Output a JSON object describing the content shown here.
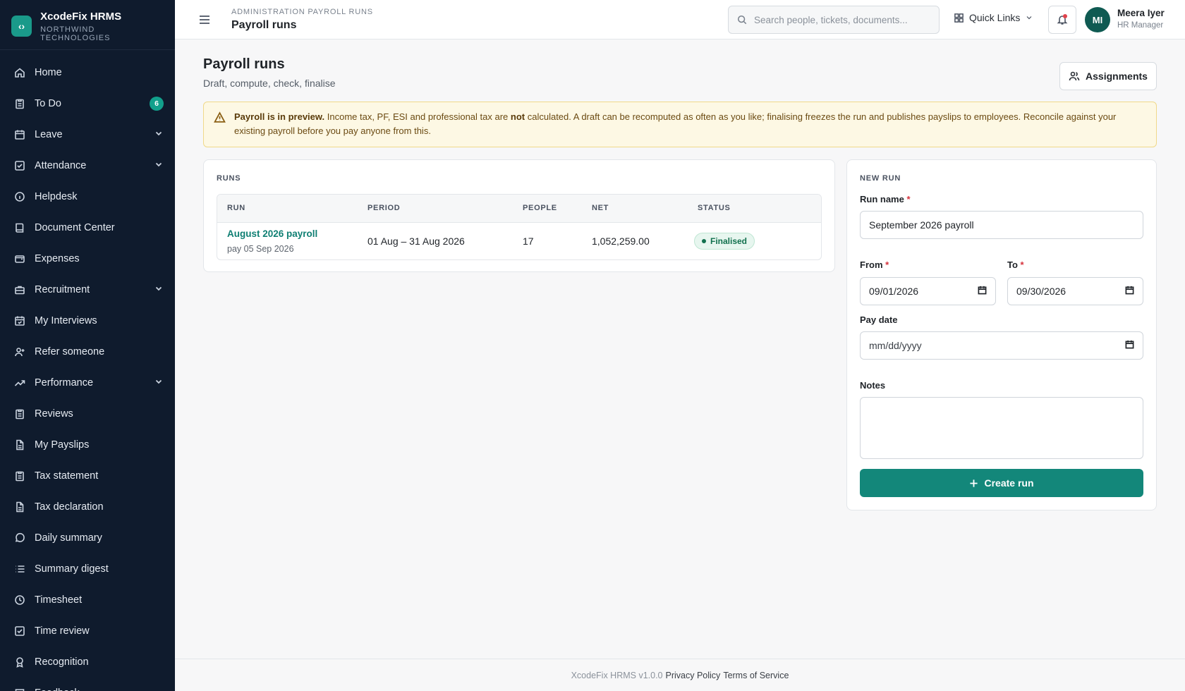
{
  "brand": {
    "name": "XcodeFix HRMS",
    "org": "NORTHWIND TECHNOLOGIES"
  },
  "sidebar": {
    "items": [
      {
        "label": "Home",
        "icon": "home-icon"
      },
      {
        "label": "To Do",
        "icon": "clipboard-icon",
        "badge": "6"
      },
      {
        "label": "Leave",
        "icon": "calendar-icon",
        "expandable": true
      },
      {
        "label": "Attendance",
        "icon": "check-square-icon",
        "expandable": true
      },
      {
        "label": "Helpdesk",
        "icon": "info-icon"
      },
      {
        "label": "Document Center",
        "icon": "book-icon"
      },
      {
        "label": "Expenses",
        "icon": "wallet-icon"
      },
      {
        "label": "Recruitment",
        "icon": "briefcase-icon",
        "expandable": true
      },
      {
        "label": "My Interviews",
        "icon": "calendar-check-icon"
      },
      {
        "label": "Refer someone",
        "icon": "user-plus-icon"
      },
      {
        "label": "Performance",
        "icon": "trending-up-icon",
        "expandable": true
      },
      {
        "label": "Reviews",
        "icon": "clipboard-icon"
      },
      {
        "label": "My Payslips",
        "icon": "file-icon"
      },
      {
        "label": "Tax statement",
        "icon": "clipboard-icon"
      },
      {
        "label": "Tax declaration",
        "icon": "file-icon"
      },
      {
        "label": "Daily summary",
        "icon": "message-circle-icon"
      },
      {
        "label": "Summary digest",
        "icon": "list-icon"
      },
      {
        "label": "Timesheet",
        "icon": "clock-icon"
      },
      {
        "label": "Time review",
        "icon": "check-square-icon"
      },
      {
        "label": "Recognition",
        "icon": "award-icon"
      },
      {
        "label": "Feedback",
        "icon": "message-icon"
      }
    ]
  },
  "header": {
    "breadcrumb": "ADMINISTRATION  PAYROLL RUNS",
    "title": "Payroll runs",
    "search_placeholder": "Search people, tickets, documents...",
    "quick_links": "Quick Links",
    "user": {
      "initials": "MI",
      "name": "Meera Iyer",
      "role": "HR Manager"
    }
  },
  "page": {
    "title": "Payroll runs",
    "subtitle": "Draft, compute, check, finalise",
    "assignments_label": "Assignments"
  },
  "alert": {
    "strong": "Payroll is in preview.",
    "text1": " Income tax, PF, ESI and professional tax are ",
    "not": "not",
    "text2": " calculated. A draft can be recomputed as often as you like; finalising freezes the run and publishes payslips to employees. Reconcile against your existing payroll before you pay anyone from this."
  },
  "runs": {
    "label": "RUNS",
    "columns": [
      "RUN",
      "PERIOD",
      "PEOPLE",
      "NET",
      "STATUS"
    ],
    "rows": [
      {
        "name": "August 2026 payroll",
        "pay": "pay 05 Sep 2026",
        "period": "01 Aug – 31 Aug 2026",
        "people": "17",
        "net": "1,052,259.00",
        "status": "Finalised"
      }
    ]
  },
  "new_run": {
    "label": "NEW RUN",
    "run_name_label": "Run name",
    "run_name_value": "September 2026 payroll",
    "from_label": "From",
    "from_value": "09/01/2026",
    "to_label": "To",
    "to_value": "09/30/2026",
    "pay_date_label": "Pay date",
    "pay_date_placeholder": "mm/dd/yyyy",
    "notes_label": "Notes",
    "required_mark": "*",
    "create_label": "Create run"
  },
  "footer": {
    "version": "XcodeFix HRMS v1.0.0",
    "privacy": "Privacy Policy",
    "terms": "Terms of Service"
  },
  "colors": {
    "accent": "#13877a",
    "sidebar_bg": "#0f1b2d",
    "alert_bg": "#fdf8e4",
    "status_green": "#12714e"
  }
}
